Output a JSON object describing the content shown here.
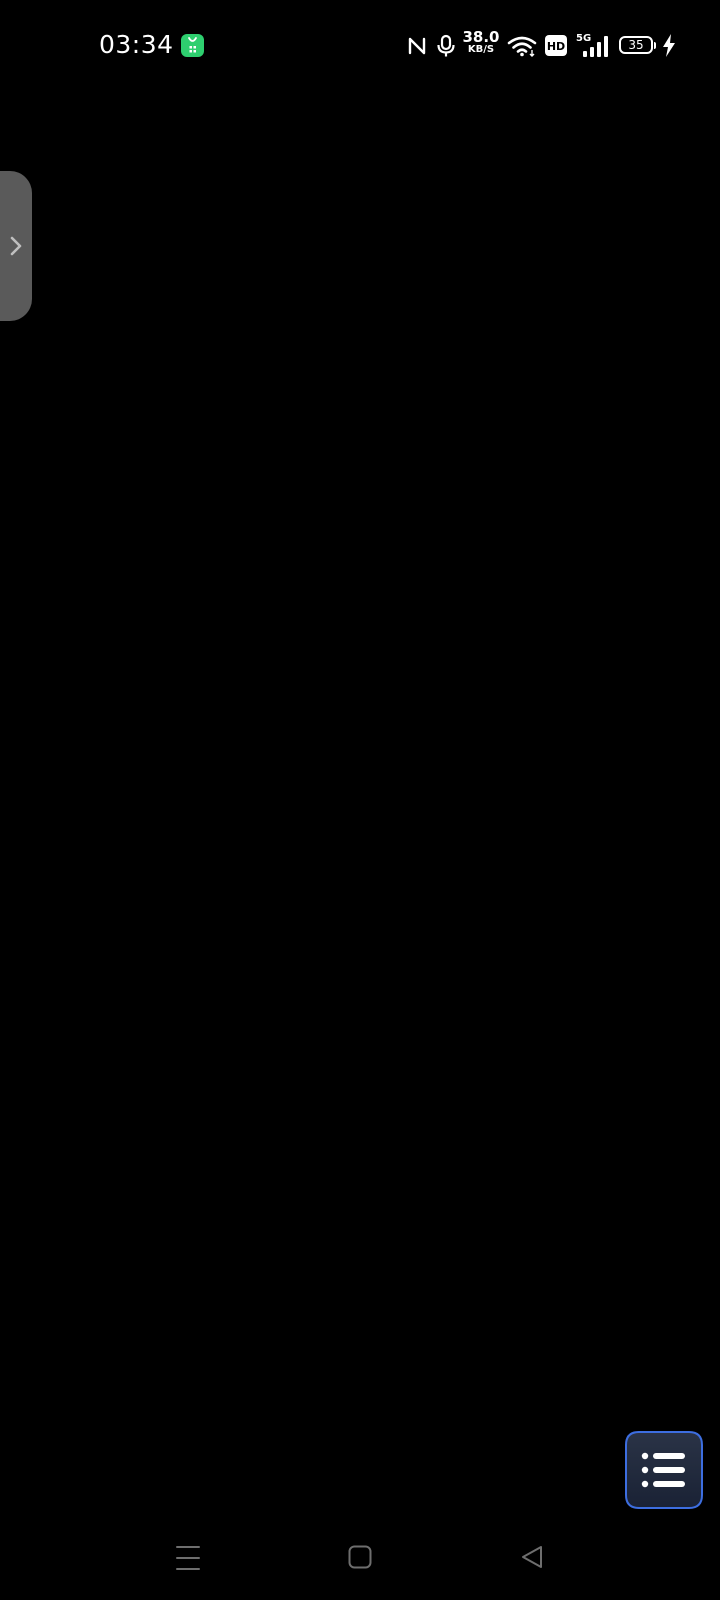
{
  "status_bar": {
    "time": "03:34",
    "notification_icon": "app-notification-icon",
    "net_speed": {
      "value": "38.0",
      "unit": "KB/S"
    },
    "network_type": "5G",
    "battery_level": "35",
    "charging": true,
    "icons": [
      "nfc-icon",
      "microphone-icon",
      "wifi-icon",
      "hd-icon",
      "signal-icon",
      "battery-icon",
      "charging-bolt-icon"
    ]
  },
  "side_panel": {
    "icon": "chevron-right-icon"
  },
  "floating_button": {
    "icon": "list-icon",
    "colors": {
      "fill": "#1f2a3d",
      "border": "#3d6ee0"
    }
  },
  "nav_bar": {
    "buttons": [
      "menu-icon",
      "home-icon",
      "back-icon"
    ]
  },
  "colors": {
    "background": "#000000",
    "notification_app": "#2ecf6f",
    "side_handle": "#5a5a5a"
  }
}
